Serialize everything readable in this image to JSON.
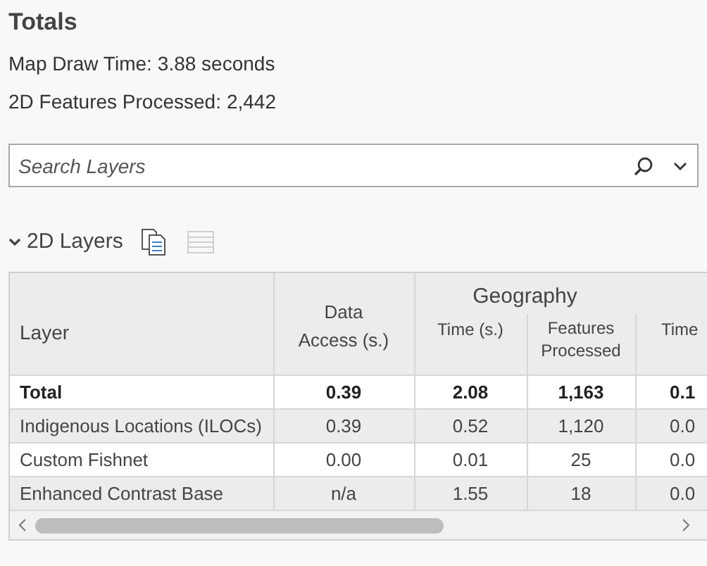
{
  "totals": {
    "title": "Totals",
    "lines": [
      {
        "label": "Map Draw Time:",
        "value": "3.88 seconds"
      },
      {
        "label": "2D Features Processed:",
        "value": "2,442"
      }
    ]
  },
  "search": {
    "placeholder": "Search Layers"
  },
  "section": {
    "title": "2D Layers",
    "expanded": true
  },
  "table": {
    "columns": {
      "layer": "Layer",
      "data_access": "Data Access (s.)",
      "group": "Geography",
      "time": "Time (s.)",
      "features": "Features Processed",
      "column_5": "Time"
    },
    "rows": [
      {
        "layer": "Total",
        "data_access": "0.39",
        "time": "2.08",
        "features": "1,163",
        "column_5": "0.1",
        "kind": "total"
      },
      {
        "layer": "Indigenous Locations (ILOCs)",
        "data_access": "0.39",
        "time": "0.52",
        "features": "1,120",
        "column_5": "0.0",
        "kind": "layer"
      },
      {
        "layer": "Custom Fishnet",
        "data_access": "0.00",
        "time": "0.01",
        "features": "25",
        "column_5": "0.0",
        "kind": "layer"
      },
      {
        "layer": "Enhanced Contrast Base",
        "data_access": "n/a",
        "time": "1.55",
        "features": "18",
        "column_5": "0.0",
        "kind": "layer"
      }
    ]
  }
}
